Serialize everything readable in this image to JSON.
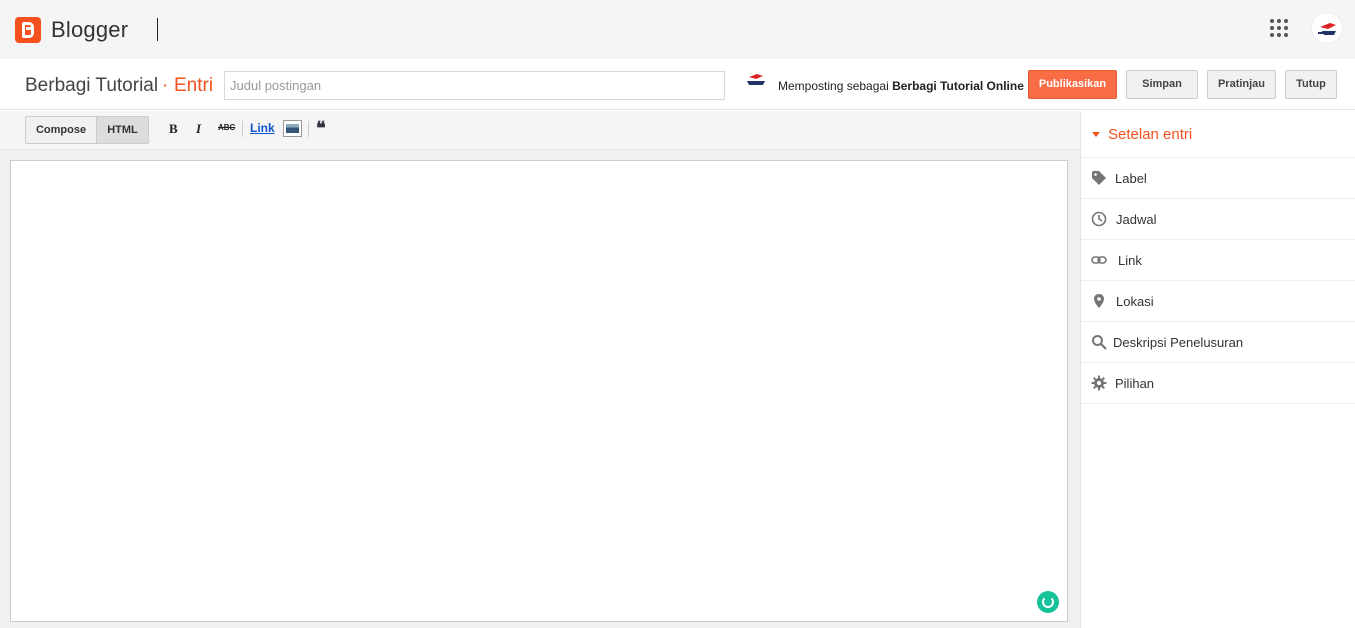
{
  "app": {
    "name": "Blogger"
  },
  "header": {
    "blog_title": "Berbagi Tutorial",
    "separator": "·",
    "section": "Entri",
    "title_placeholder": "Judul postingan",
    "posting_as_prefix": "Memposting sebagai",
    "posting_as_name": "Berbagi Tutorial Online"
  },
  "actions": {
    "publish": "Publikasikan",
    "save": "Simpan",
    "preview": "Pratinjau",
    "close": "Tutup"
  },
  "toolbar": {
    "compose": "Compose",
    "html": "HTML",
    "bold": "B",
    "italic": "I",
    "strike": "ABC",
    "link": "Link",
    "quote": "❝"
  },
  "sidebar": {
    "title": "Setelan entri",
    "items": [
      {
        "label": "Label",
        "icon": "label-tag-icon"
      },
      {
        "label": "Jadwal",
        "icon": "clock-icon"
      },
      {
        "label": "Link",
        "icon": "link-icon"
      },
      {
        "label": "Lokasi",
        "icon": "location-pin-icon"
      },
      {
        "label": "Deskripsi Penelusuran",
        "icon": "search-icon"
      },
      {
        "label": "Pilihan",
        "icon": "gear-icon"
      }
    ]
  },
  "colors": {
    "brand": "#f4511e",
    "publish_button": "#f86d46",
    "grammarly": "#15c39a"
  }
}
